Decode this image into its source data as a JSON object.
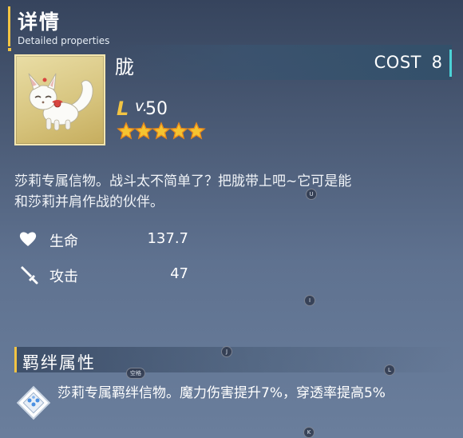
{
  "header": {
    "title": "详情",
    "subtitle": "Detailed properties"
  },
  "item": {
    "name": "胧",
    "cost_label": "COST",
    "cost_value": "8",
    "level_mark": "L",
    "level_dot": "v.",
    "level_value": "50",
    "stars": 5,
    "description_line1": "莎莉专属信物。战斗太不简单了？把胧带上吧~它可是能",
    "description_line2": "和莎莉并肩作战的伙伴。"
  },
  "stats": [
    {
      "icon": "heart-icon",
      "label": "生命",
      "value": "137.7"
    },
    {
      "icon": "sword-icon",
      "label": "攻击",
      "value": "47"
    }
  ],
  "bond": {
    "title": "羁绊属性",
    "text": "莎莉专属羁绊信物。魔力伤害提升7%，穿透率提高5%"
  },
  "hints": [
    {
      "key": "U"
    },
    {
      "key": "I"
    },
    {
      "key": "J"
    },
    {
      "key": "空格"
    },
    {
      "key": "L"
    },
    {
      "key": "K"
    }
  ],
  "colors": {
    "accent_gold": "#f2c443",
    "accent_cyan": "#4bd2d6",
    "star_yellow": "#f5c431",
    "star_orange": "#e88a1a"
  }
}
